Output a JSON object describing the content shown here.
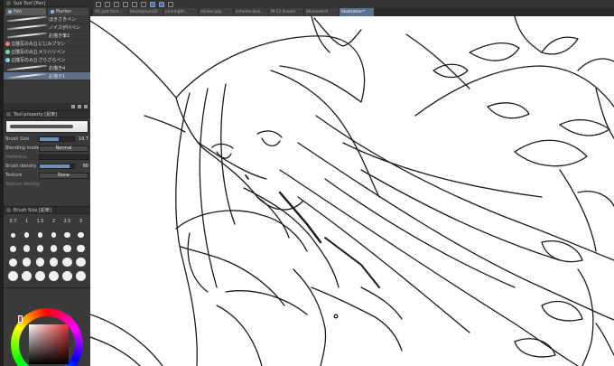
{
  "subtool": {
    "header": "Sub Tool [Pen]",
    "tabs": [
      {
        "label": "Pen",
        "active": true
      },
      {
        "label": "Marker",
        "active": false
      }
    ],
    "brushes": [
      {
        "label": "ほきさきペン",
        "selected": false
      },
      {
        "label": "ノイズがけペン",
        "selected": false
      },
      {
        "label": "お描き筆2",
        "selected": false
      },
      {
        "label": "[[描写のみ]] にじみブラシ",
        "selected": false
      },
      {
        "label": "[[描写のみ]] メリハリペン",
        "selected": false
      },
      {
        "label": "[[描写のみ]] ざらざらペン",
        "selected": false
      },
      {
        "label": "お描き4",
        "selected": false
      },
      {
        "label": "お描き1",
        "selected": true
      }
    ]
  },
  "tool_property": {
    "header": "Tool property [鉛筆]",
    "brush_size_label": "Brush Size",
    "brush_size_value": "19.7",
    "blending_label": "Blending mode",
    "blending_value": "Normal",
    "hardness_label": "Hardness",
    "density_label": "Brush density",
    "density_value": "88",
    "texture_label": "Texture",
    "texture_value": "None",
    "texture_density_label": "Texture density"
  },
  "brush_size_panel": {
    "header": "Brush Size [鉛筆]",
    "sizes": [
      "0.7",
      "1",
      "1.5",
      "2",
      "2.5",
      "3",
      "",
      "",
      "",
      "",
      "",
      "",
      "",
      "",
      "",
      "",
      "",
      "",
      "",
      "",
      "",
      "",
      "",
      "",
      "",
      "",
      "",
      "",
      "",
      ""
    ]
  },
  "document_tabs": [
    {
      "label": "05_pet face...",
      "active": false
    },
    {
      "label": "blackground2",
      "active": false
    },
    {
      "label": "pinknight...",
      "active": false
    },
    {
      "label": "sticker.jpg...",
      "active": false
    },
    {
      "label": "scheme bus...",
      "active": false
    },
    {
      "label": "M-12 lineart",
      "active": false
    },
    {
      "label": "bluesketch",
      "active": false
    },
    {
      "label": "Illustration*",
      "active": true
    }
  ],
  "colors": {
    "accent": "#5b6f8f",
    "selected_color": "#e03c5a"
  }
}
